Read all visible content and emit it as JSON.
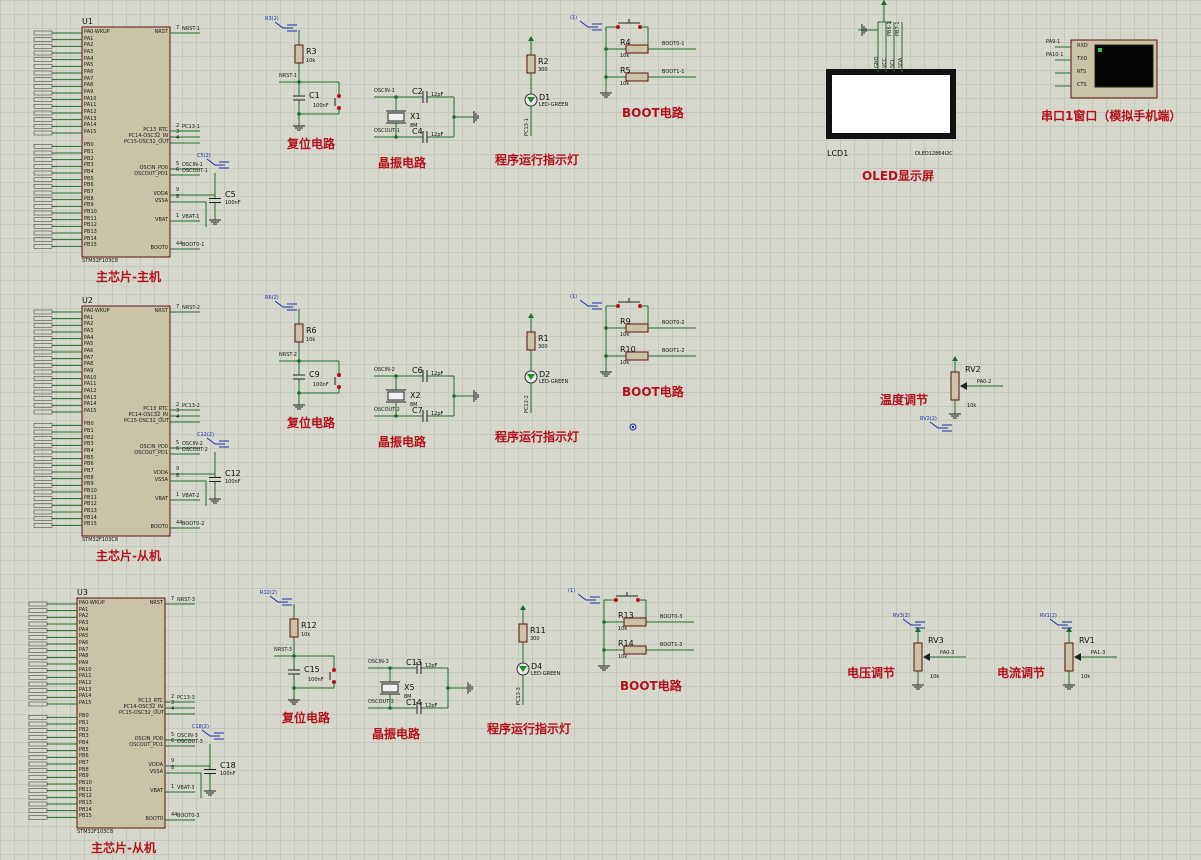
{
  "sections": {
    "master": "主芯片-主机",
    "slave": "主芯片-从机"
  },
  "mcu": {
    "U1": {
      "ref": "U1",
      "part": "STM32F103C8"
    },
    "U2": {
      "ref": "U2",
      "part": "STM32F103C8"
    },
    "U3": {
      "ref": "U3",
      "part": "STM32F103C8"
    },
    "left_pins": [
      "PA0-WKUP",
      "PA1",
      "PA2",
      "PA3",
      "PA4",
      "PA5",
      "PA6",
      "PA7",
      "PA8",
      "PA9",
      "PA10",
      "PA11",
      "PA12",
      "PA13",
      "PA14",
      "PA15",
      "",
      "PB0",
      "PB1",
      "PB2",
      "PB3",
      "PB4",
      "PB5",
      "PB6",
      "PB7",
      "PB8",
      "PB9",
      "PB10",
      "PB11",
      "PB12",
      "PB13",
      "PB14",
      "PB15"
    ],
    "right_pins": {
      "nrst": "NRST",
      "pc13": "PC13_RTC",
      "pc14": "PC14-OSC32_IN",
      "pc15": "PC15-OSC32_OUT",
      "oscin": "OSCIN_PD0",
      "oscout": "OSCOUT_PD1",
      "vdda": "VDDA",
      "vssa": "VSSA",
      "vbat": "VBAT",
      "boot0": "BOOT0"
    },
    "right_nums": {
      "nrst": "7",
      "pc13": "2",
      "pc14": "3",
      "pc15": "4",
      "oscin": "5",
      "oscout": "6",
      "vdda": "9",
      "vssa": "8",
      "vbat": "1",
      "boot0": "44"
    }
  },
  "blocks": {
    "reset": "复位电路",
    "crystal": "晶振电路",
    "led": "程序运行指示灯",
    "boot": "BOOT电路"
  },
  "values": {
    "r10k": "10k",
    "r300": "300",
    "c100n": "100nF",
    "c12p": "12pF",
    "x8m": "8M",
    "led": "LED-GREEN"
  },
  "row1": {
    "reset_r": "R3",
    "reset_c": "C1",
    "term": "R3(2)",
    "nrst": "NRST-1",
    "x": "X1",
    "c_a": "C2",
    "c_b": "C4",
    "oscin": "OSCIN-1",
    "oscout": "OSCOUT-1",
    "led_r": "R2",
    "led_d": "D1",
    "pc13": "PC13-1",
    "boot_ra": "R4",
    "boot_rb": "R5",
    "boot0": "BOOT0-1",
    "boot1": "BOOT1-1",
    "boot_term": "(1)",
    "vcap": "C5",
    "vcap_term": "C5(2)",
    "vbat": "VBAT-1"
  },
  "row2": {
    "reset_r": "R6",
    "reset_c": "C9",
    "term": "R6(2)",
    "nrst": "NRST-2",
    "x": "X2",
    "c_a": "C6",
    "c_b": "C7",
    "oscin": "OSCIN-2",
    "oscout": "OSCOUT-2",
    "led_r": "R1",
    "led_d": "D2",
    "pc13": "PC13-2",
    "boot_ra": "R9",
    "boot_rb": "R10",
    "boot0": "BOOT0-2",
    "boot1": "BOOT1-2",
    "boot_term": "(1)",
    "vcap": "C12",
    "vcap_term": "C12(2)",
    "vbat": "VBAT-2"
  },
  "row3": {
    "reset_r": "R12",
    "reset_c": "C15",
    "term": "R12(2)",
    "nrst": "NRST-3",
    "x": "X5",
    "c_a": "C13",
    "c_b": "C14",
    "oscin": "OSCIN-3",
    "oscout": "OSCOUT-3",
    "led_r": "R11",
    "led_d": "D4",
    "pc13": "PC13-3",
    "boot_ra": "R13",
    "boot_rb": "R14",
    "boot0": "BOOT0-3",
    "boot1": "BOOT1-3",
    "boot_term": "(1)",
    "vcap": "C18",
    "vcap_term": "C18(2)",
    "vbat": "VBAT-3"
  },
  "oled": {
    "ref": "LCD1",
    "part": "OLED12864I2C",
    "title": "OLED显示屏",
    "pins": [
      "GND",
      "VCC",
      "SCL",
      "SDA"
    ],
    "nets": [
      "PB6-1",
      "PB7-1"
    ]
  },
  "serial": {
    "title": "串口1窗口（模拟手机端）",
    "pins": [
      "RXD",
      "TXD",
      "RTS",
      "CTS"
    ],
    "nets": [
      "PA9-1",
      "PA10-1"
    ]
  },
  "pots": {
    "temp": {
      "ref": "RV2",
      "label": "温度调节",
      "net": "PA0-2",
      "value": "10k",
      "term": "RV2(2)"
    },
    "volt": {
      "ref": "RV3",
      "label": "电压调节",
      "net": "PA0-3",
      "value": "10k",
      "term": "RV3(2)"
    },
    "curr": {
      "ref": "RV1",
      "label": "电流调节",
      "net": "PA1-3",
      "value": "10k",
      "term": "RV1(2)"
    }
  },
  "colors": {
    "wire": "#1f6b2a",
    "body": "#c8c4a5",
    "bodyEdge": "#5d0f0f",
    "red": "#b3121a",
    "blue": "#1f2fa3",
    "grid": "#c5c7bc"
  }
}
